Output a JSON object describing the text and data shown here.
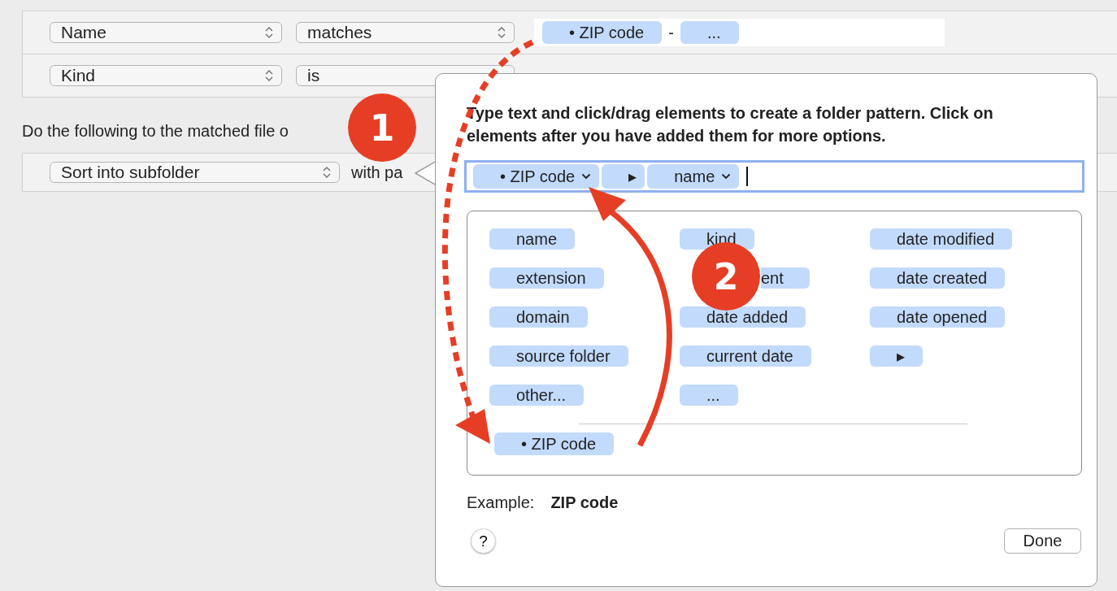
{
  "criteria": [
    {
      "attribute": "Name",
      "operator": "matches",
      "value_tokens": [
        {
          "kind": "token",
          "label": "• ZIP code"
        },
        {
          "kind": "text",
          "label": "-"
        },
        {
          "kind": "token",
          "label": "..."
        }
      ]
    },
    {
      "attribute": "Kind",
      "operator": "is"
    }
  ],
  "actions_heading": "Do the following to the matched file o",
  "action": {
    "type": "Sort into subfolder",
    "suffix": "with pa"
  },
  "popover": {
    "instructions": "Type text and click/drag elements to create a folder pattern. Click on elements after you have added them for more options.",
    "pattern": [
      {
        "label": "• ZIP code",
        "has_menu": true
      },
      {
        "label": "▸",
        "has_menu": false
      },
      {
        "label": "name",
        "has_menu": true
      }
    ],
    "elements": [
      {
        "label": "name"
      },
      {
        "label": "kind"
      },
      {
        "label": "date modified"
      },
      {
        "label": "extension"
      },
      {
        "label": "ent"
      },
      {
        "label": "date created"
      },
      {
        "label": "domain"
      },
      {
        "label": "date added"
      },
      {
        "label": "date opened"
      },
      {
        "label": "source folder"
      },
      {
        "label": "current date"
      },
      {
        "label": "▸"
      },
      {
        "label": "other..."
      },
      {
        "label": "..."
      }
    ],
    "custom_elements": [
      {
        "label": "• ZIP code"
      }
    ],
    "example_label": "Example:",
    "example_value": "ZIP code",
    "help_button": "?",
    "done_button": "Done"
  },
  "annotations": [
    {
      "label": "1"
    },
    {
      "label": "2"
    }
  ]
}
